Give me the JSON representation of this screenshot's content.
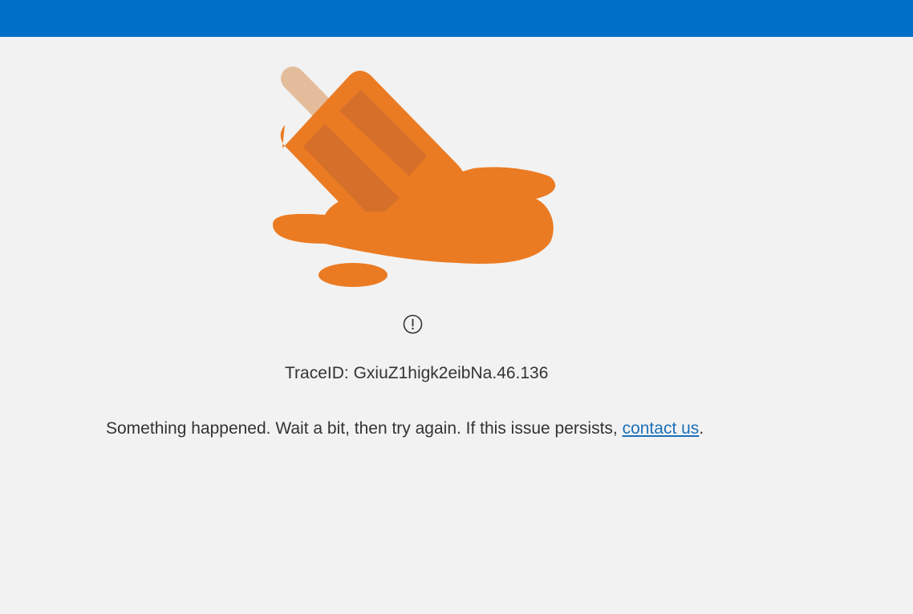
{
  "header": {
    "bar_color": "#006fc8"
  },
  "illustration": {
    "icon": "melted-popsicle-illustration",
    "color": "#eb7b23"
  },
  "status": {
    "icon": "exclamation-circle-icon",
    "trace_label": "TraceID:",
    "trace_value": "GxiuZ1higk2eibNa.46.136"
  },
  "message": {
    "text": "Something happened. Wait a bit, then try again. If this issue persists,",
    "link_label": "contact us",
    "suffix": "."
  }
}
